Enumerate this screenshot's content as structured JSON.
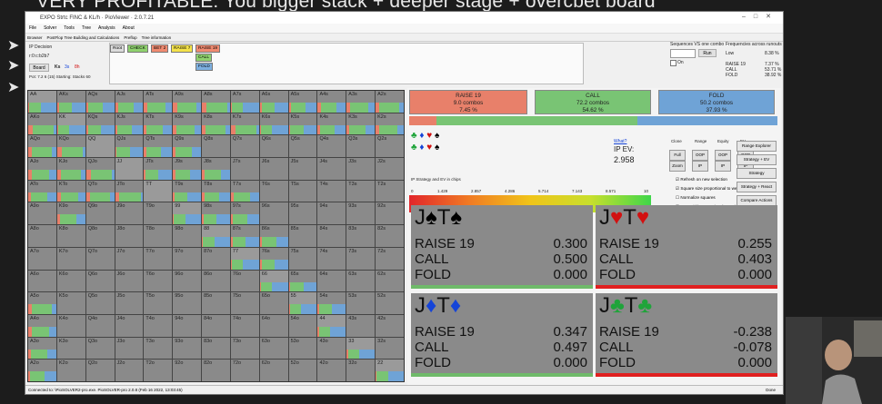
{
  "slide": {
    "title": "VERY PROFITABLE: You bigger stack + deeper stage + overcbet board",
    "bullets": [
      "➤",
      "➤",
      "➤"
    ]
  },
  "window": {
    "title": "EXPO Strtc FINC & KL/h · PioViewer · 2.0.7.21",
    "menu": [
      "File",
      "Solver",
      "Tools",
      "Tree",
      "Analysis",
      "About"
    ],
    "tabs": [
      "Browser",
      "PostFlop Tree Building and Calculations",
      "Preflop",
      "Tree information"
    ],
    "status": "Connected to: \\PioSOLVER2-pro.exe. PioSOLVER-pro 2.0.8 (Feb 16 2022, 13:03:45)",
    "status_right": "Done"
  },
  "decision": {
    "label": "IP Decision",
    "board_input": "r:0:c:b2b7",
    "board_button": "Board",
    "board_cards": [
      "Ks",
      "3s",
      "8h"
    ],
    "pot_info": "Pot: 7.2 6 (15) Starting: Stacks 60"
  },
  "tree_nodes": [
    "Root",
    "CHECK",
    "BET 2",
    "RAISE 7",
    "RAISE 19",
    "CALL",
    "FOLD"
  ],
  "right_top": {
    "seq_label": "Sequences VS one combo",
    "run_button": "Run",
    "on_label": "On",
    "freq_title": "Frequencies across runouts",
    "freq_low": "Low",
    "freq_low_val": "8.38 %",
    "freq_rows": [
      {
        "label": "RAISE 19",
        "val": "7.37 %"
      },
      {
        "label": "CALL",
        "val": "53.71 %"
      },
      {
        "label": "FOLD",
        "val": "38.92 %"
      }
    ]
  },
  "strategy": {
    "actions": [
      {
        "name": "RAISE 19",
        "combos": "9.0 combos",
        "pct": "7.45 %",
        "color": "#e8806a"
      },
      {
        "name": "CALL",
        "combos": "72.2 combos",
        "pct": "54.62 %",
        "color": "#79c474"
      },
      {
        "name": "FOLD",
        "combos": "50.2 combos",
        "pct": "37.93 %",
        "color": "#6fa3d6"
      }
    ],
    "what_link": "What?",
    "ip_ev_label": "IP EV:",
    "ip_ev_value": "2.958",
    "scale_label": "IP Strategy and EV in chips",
    "scale_ticks": [
      "0",
      "1.429",
      "2.857",
      "4.286",
      "5.714",
      "7.143",
      "8.571",
      "10"
    ],
    "suit_glyphs": [
      "♣",
      "♦",
      "♥",
      "♠",
      "♣",
      "♦",
      "♥",
      "♠"
    ],
    "tool_cols": [
      "Clone",
      "Range",
      "Equity",
      "EV"
    ],
    "tool_row1": [
      "Full",
      "OOP",
      "OOP",
      "OOP"
    ],
    "tool_row2": [
      "Zoom",
      "IP",
      "IP",
      "IP"
    ],
    "checks": [
      {
        "label": "Refresh on new selection",
        "on": true
      },
      {
        "label": "Square size proportional to weight",
        "on": true
      },
      {
        "label": "Normalize squares",
        "on": false
      },
      {
        "label": "Bars width proportional to weight",
        "on": true
      }
    ],
    "side_buttons": [
      "Range Explorer",
      "Strategy + EV",
      "Strategy",
      "Strategy + React",
      "Compare Actions"
    ]
  },
  "combos": [
    {
      "title": "J♠T♠",
      "suitColor": "#000000",
      "rows": [
        {
          "a": "RAISE 19",
          "v": "0.300"
        },
        {
          "a": "CALL",
          "v": "0.500"
        },
        {
          "a": "FOLD",
          "v": "0.000"
        }
      ],
      "underline": "#6fba6a"
    },
    {
      "title": "J♥T♥",
      "suitColor": "#d21010",
      "rows": [
        {
          "a": "RAISE 19",
          "v": "0.255"
        },
        {
          "a": "CALL",
          "v": "0.403"
        },
        {
          "a": "FOLD",
          "v": "0.000"
        }
      ],
      "underline": "#e02020"
    },
    {
      "title": "J♦T♦",
      "suitColor": "#1544d8",
      "rows": [
        {
          "a": "RAISE 19",
          "v": "0.347"
        },
        {
          "a": "CALL",
          "v": "0.497"
        },
        {
          "a": "FOLD",
          "v": "0.000"
        }
      ],
      "underline": "#6fba6a"
    },
    {
      "title": "J♣T♣",
      "suitColor": "#1fa43a",
      "rows": [
        {
          "a": "RAISE 19",
          "v": "-0.238"
        },
        {
          "a": "CALL",
          "v": "-0.078"
        },
        {
          "a": "FOLD",
          "v": "0.000"
        }
      ],
      "underline": "#e02020"
    }
  ],
  "hands": [
    [
      "AA",
      "AKs",
      "AQs",
      "AJs",
      "ATs",
      "A9s",
      "A8s",
      "A7s",
      "A6s",
      "A5s",
      "A4s",
      "A3s",
      "A2s"
    ],
    [
      "AKo",
      "KK",
      "KQs",
      "KJs",
      "KTs",
      "K9s",
      "K8s",
      "K7s",
      "K6s",
      "K5s",
      "K4s",
      "K3s",
      "K2s"
    ],
    [
      "AQo",
      "KQo",
      "QQ",
      "QJs",
      "QTs",
      "Q9s",
      "Q8s",
      "Q7s",
      "Q6s",
      "Q5s",
      "Q4s",
      "Q3s",
      "Q2s"
    ],
    [
      "AJo",
      "KJo",
      "QJo",
      "JJ",
      "JTs",
      "J9s",
      "J8s",
      "J7s",
      "J6s",
      "J5s",
      "J4s",
      "J3s",
      "J2s"
    ],
    [
      "ATo",
      "KTo",
      "QTo",
      "JTo",
      "TT",
      "T9s",
      "T8s",
      "T7s",
      "T6s",
      "T5s",
      "T4s",
      "T3s",
      "T2s"
    ],
    [
      "A9o",
      "K9o",
      "Q9o",
      "J9o",
      "T9o",
      "99",
      "98s",
      "97s",
      "96s",
      "95s",
      "94s",
      "93s",
      "92s"
    ],
    [
      "A8o",
      "K8o",
      "Q8o",
      "J8o",
      "T8o",
      "98o",
      "88",
      "87s",
      "86s",
      "85s",
      "84s",
      "83s",
      "82s"
    ],
    [
      "A7o",
      "K7o",
      "Q7o",
      "J7o",
      "T7o",
      "97o",
      "87o",
      "77",
      "76s",
      "75s",
      "74s",
      "73s",
      "72s"
    ],
    [
      "A6o",
      "K6o",
      "Q6o",
      "J6o",
      "T6o",
      "96o",
      "86o",
      "76o",
      "66",
      "65s",
      "64s",
      "63s",
      "62s"
    ],
    [
      "A5o",
      "K5o",
      "Q5o",
      "J5o",
      "T5o",
      "95o",
      "85o",
      "75o",
      "65o",
      "55",
      "54s",
      "53s",
      "52s"
    ],
    [
      "A4o",
      "K4o",
      "Q4o",
      "J4o",
      "T4o",
      "94o",
      "84o",
      "74o",
      "64o",
      "54o",
      "44",
      "43s",
      "42s"
    ],
    [
      "A3o",
      "K3o",
      "Q3o",
      "J3o",
      "T3o",
      "93o",
      "83o",
      "73o",
      "63o",
      "53o",
      "43o",
      "33",
      "32s"
    ],
    [
      "A2o",
      "K2o",
      "Q2o",
      "J2o",
      "T2o",
      "92o",
      "82o",
      "72o",
      "62o",
      "52o",
      "42o",
      "32o",
      "22"
    ]
  ],
  "highlighted_hands": [
    "AA",
    "AKs",
    "AQs",
    "AJs",
    "ATs",
    "A9s",
    "A8s",
    "A7s",
    "A6s",
    "A5s",
    "A4s",
    "A3s",
    "A2s",
    "AKo",
    "KK",
    "KQs",
    "KJs",
    "KTs",
    "K9s",
    "K8s",
    "K7s",
    "K6s",
    "K5s",
    "K4s",
    "K3s",
    "K2s",
    "KQo",
    "KJo",
    "QJs",
    "QTs",
    "Q9s",
    "KTo",
    "JTs",
    "J9s",
    "J8s",
    "K9o",
    "T9s",
    "T8s",
    "T7s",
    "99",
    "98s",
    "97s",
    "88",
    "87s",
    "86s",
    "77",
    "76s",
    "66",
    "65s",
    "55",
    "54s",
    "44",
    "33",
    "22",
    "A2o",
    "A3o",
    "A4o",
    "A5o",
    "AJo",
    "ATo",
    "AQo",
    "QJo",
    "JTo",
    "QTo"
  ]
}
